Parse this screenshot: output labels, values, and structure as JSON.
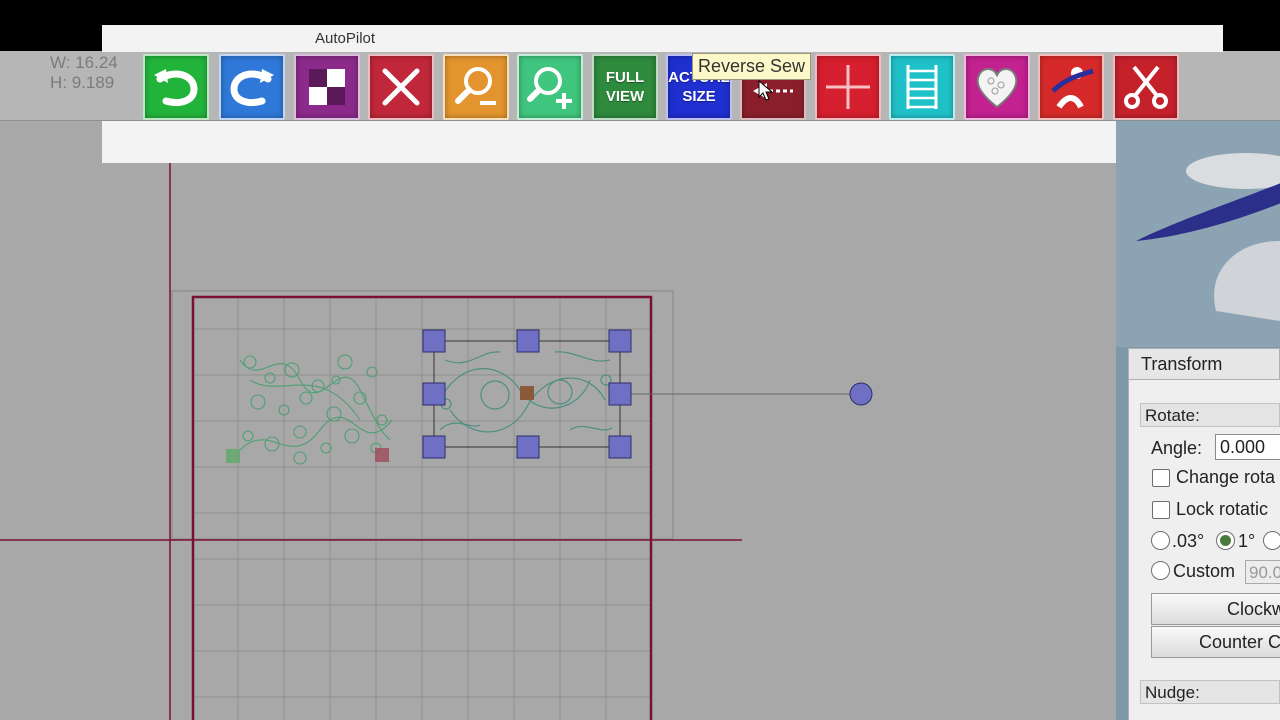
{
  "window": {
    "title": "AutoPilot"
  },
  "dimensions": {
    "width": "W: 16.24",
    "height": "H: 9.189"
  },
  "toolbar": {
    "buttons": [
      {
        "name": "undo",
        "label": "",
        "color": "#22b33a"
      },
      {
        "name": "redo",
        "label": "",
        "color": "#2f78d8"
      },
      {
        "name": "select-pattern",
        "label": "",
        "color": "#8b2a8b"
      },
      {
        "name": "delete",
        "label": "",
        "color": "#c0273a"
      },
      {
        "name": "zoom-out",
        "label": "",
        "color": "#e3942e"
      },
      {
        "name": "zoom-in",
        "label": "",
        "color": "#3fc57d"
      },
      {
        "name": "full-view",
        "label": "FULL\nVIEW",
        "color": "#2e8a3c"
      },
      {
        "name": "actual-size",
        "label": "ACTUAL\nSIZE",
        "color": "#1f2fd0"
      },
      {
        "name": "reverse-sew",
        "label": "",
        "color": "#8a1f2b"
      },
      {
        "name": "crosshair",
        "label": "",
        "color": "#d61f2f"
      },
      {
        "name": "ladder",
        "label": "",
        "color": "#1fc1c8"
      },
      {
        "name": "heart-pattern",
        "label": "",
        "color": "#c2218f"
      },
      {
        "name": "quilter",
        "label": "",
        "color": "#d62a2a"
      },
      {
        "name": "cut",
        "label": "",
        "color": "#c4212b"
      }
    ],
    "tooltip": "Reverse Sew"
  },
  "panel": {
    "title": "Transform",
    "rotate": {
      "heading": "Rotate:",
      "angle_label": "Angle:",
      "angle_value": "0.000",
      "change_rotation_label": "Change rota",
      "lock_rotation_label": "Lock rotatic",
      "step_03": ".03°",
      "step_1": "1°",
      "custom_label": "Custom",
      "custom_value": "90.0",
      "clockwise_label": "Clockw",
      "counter_clockwise_label": "Counter Cl"
    },
    "nudge": {
      "heading": "Nudge:"
    }
  },
  "colors": {
    "workspace": "#a8a8a8",
    "grid_line": "#8c8c8c",
    "frame_line": "#7a1030",
    "selection_handle": "#6f6fc4",
    "pattern_green": "#4f9f74"
  }
}
